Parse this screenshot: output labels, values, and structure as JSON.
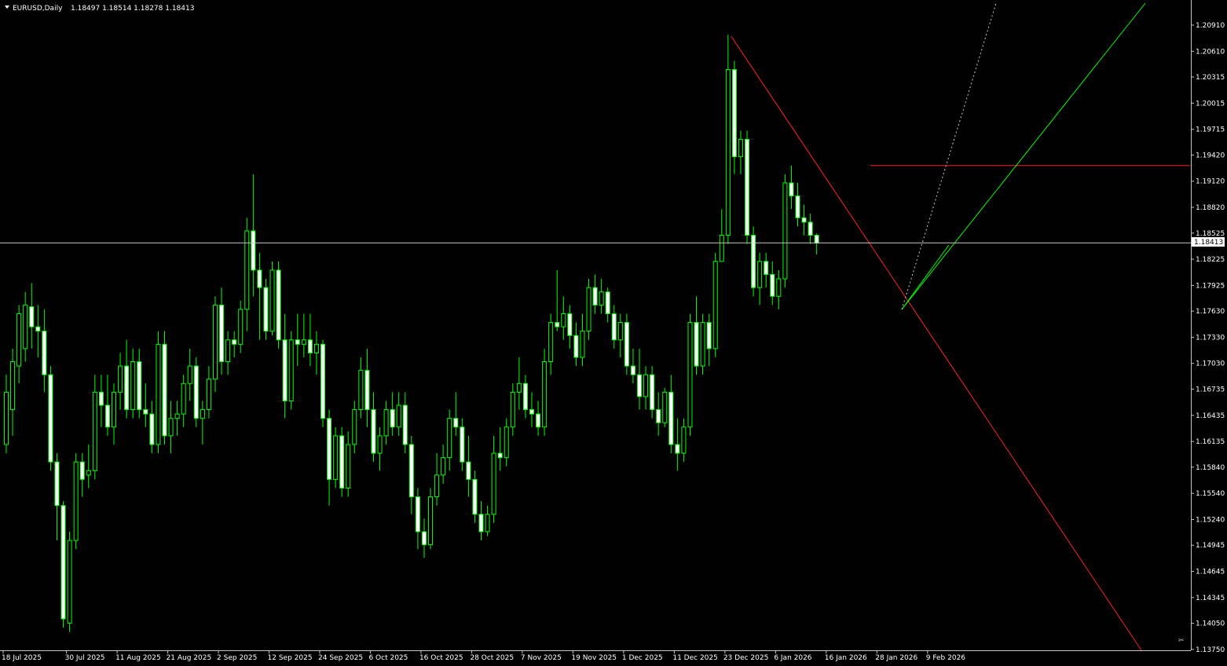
{
  "colors": {
    "background": "#000000",
    "foreground": "#ffffff",
    "bull": "#00ff00",
    "bull_body": "#000000",
    "bear_body": "#ffffff",
    "wick": "#00ff00",
    "bid_line": "#c8c8c8",
    "red_lines": "#ff2020",
    "green_lines": "#00ff00",
    "dotted_line": "#c8c8c8"
  },
  "header": {
    "symbol_text": "EURUSD,Daily",
    "ohlc_text": "1.18497 1.18514 1.18278 1.18413"
  },
  "price_marker": "1.18413",
  "chart_data": {
    "type": "candlestick",
    "title": "EURUSD,Daily",
    "y_ticks": [
      "1.20910",
      "1.20610",
      "1.20315",
      "1.20015",
      "1.19715",
      "1.19420",
      "1.19120",
      "1.18820",
      "1.18525",
      "1.18225",
      "1.17925",
      "1.17630",
      "1.17330",
      "1.17030",
      "1.16735",
      "1.16435",
      "1.16135",
      "1.15840",
      "1.15540",
      "1.15240",
      "1.14945",
      "1.14645",
      "1.14345",
      "1.14050",
      "1.13750"
    ],
    "y_tick_values": [
      1.2091,
      1.2061,
      1.20315,
      1.20015,
      1.19715,
      1.1942,
      1.1912,
      1.1882,
      1.18525,
      1.18225,
      1.17925,
      1.1763,
      1.1733,
      1.1703,
      1.16735,
      1.16435,
      1.16135,
      1.1584,
      1.1554,
      1.1524,
      1.14945,
      1.14645,
      1.14345,
      1.1405,
      1.1375
    ],
    "ylim": [
      1.1374,
      1.2118
    ],
    "x_labels": [
      {
        "label": "18 Jul 2025",
        "bar": 0
      },
      {
        "label": "30 Jul 2025",
        "bar": 10
      },
      {
        "label": "11 Aug 2025",
        "bar": 18
      },
      {
        "label": "21 Aug 2025",
        "bar": 26
      },
      {
        "label": "2 Sep 2025",
        "bar": 34
      },
      {
        "label": "12 Sep 2025",
        "bar": 42
      },
      {
        "label": "24 Sep 2025",
        "bar": 50
      },
      {
        "label": "6 Oct 2025",
        "bar": 58
      },
      {
        "label": "16 Oct 2025",
        "bar": 66
      },
      {
        "label": "28 Oct 2025",
        "bar": 74
      },
      {
        "label": "7 Nov 2025",
        "bar": 82
      },
      {
        "label": "19 Nov 2025",
        "bar": 90
      },
      {
        "label": "1 Dec 2025",
        "bar": 98
      },
      {
        "label": "11 Dec 2025",
        "bar": 106
      },
      {
        "label": "23 Dec 2025",
        "bar": 114
      },
      {
        "label": "6 Jan 2026",
        "bar": 122
      },
      {
        "label": "16 Jan 2026",
        "bar": 130
      },
      {
        "label": "28 Jan 2026",
        "bar": 138
      },
      {
        "label": "9 Feb 2026",
        "bar": 146
      }
    ],
    "candles": [
      [
        1.161,
        1.169,
        1.16,
        1.167
      ],
      [
        1.165,
        1.172,
        1.162,
        1.1705
      ],
      [
        1.17,
        1.177,
        1.168,
        1.176
      ],
      [
        1.172,
        1.1785,
        1.1705,
        1.177
      ],
      [
        1.1768,
        1.1795,
        1.172,
        1.1745
      ],
      [
        1.1745,
        1.177,
        1.171,
        1.174
      ],
      [
        1.174,
        1.1765,
        1.167,
        1.169
      ],
      [
        1.169,
        1.17,
        1.158,
        1.159
      ],
      [
        1.159,
        1.16,
        1.15,
        1.154
      ],
      [
        1.154,
        1.1545,
        1.14,
        1.141
      ],
      [
        1.1405,
        1.151,
        1.1395,
        1.15
      ],
      [
        1.15,
        1.16,
        1.149,
        1.159
      ],
      [
        1.159,
        1.16,
        1.155,
        1.157
      ],
      [
        1.1575,
        1.161,
        1.156,
        1.158
      ],
      [
        1.158,
        1.169,
        1.157,
        1.167
      ],
      [
        1.167,
        1.169,
        1.163,
        1.1655
      ],
      [
        1.1655,
        1.169,
        1.162,
        1.163
      ],
      [
        1.163,
        1.168,
        1.161,
        1.167
      ],
      [
        1.167,
        1.1715,
        1.165,
        1.17
      ],
      [
        1.17,
        1.173,
        1.164,
        1.165
      ],
      [
        1.165,
        1.172,
        1.164,
        1.1705
      ],
      [
        1.1705,
        1.172,
        1.164,
        1.165
      ],
      [
        1.165,
        1.168,
        1.163,
        1.1645
      ],
      [
        1.1645,
        1.166,
        1.16,
        1.161
      ],
      [
        1.161,
        1.174,
        1.16,
        1.1725
      ],
      [
        1.1725,
        1.174,
        1.161,
        1.162
      ],
      [
        1.162,
        1.166,
        1.16,
        1.164
      ],
      [
        1.164,
        1.166,
        1.162,
        1.1645
      ],
      [
        1.1645,
        1.169,
        1.163,
        1.168
      ],
      [
        1.168,
        1.172,
        1.166,
        1.17
      ],
      [
        1.17,
        1.171,
        1.163,
        1.164
      ],
      [
        1.164,
        1.166,
        1.161,
        1.165
      ],
      [
        1.165,
        1.17,
        1.164,
        1.1685
      ],
      [
        1.1685,
        1.178,
        1.167,
        1.177
      ],
      [
        1.177,
        1.179,
        1.169,
        1.1705
      ],
      [
        1.1705,
        1.174,
        1.169,
        1.173
      ],
      [
        1.173,
        1.174,
        1.171,
        1.1725
      ],
      [
        1.1725,
        1.1775,
        1.1715,
        1.1765
      ],
      [
        1.1765,
        1.187,
        1.174,
        1.1855
      ],
      [
        1.1855,
        1.192,
        1.178,
        1.181
      ],
      [
        1.181,
        1.183,
        1.173,
        1.179
      ],
      [
        1.179,
        1.18,
        1.173,
        1.174
      ],
      [
        1.174,
        1.182,
        1.1735,
        1.181
      ],
      [
        1.181,
        1.182,
        1.172,
        1.173
      ],
      [
        1.173,
        1.176,
        1.164,
        1.166
      ],
      [
        1.166,
        1.174,
        1.165,
        1.173
      ],
      [
        1.173,
        1.176,
        1.17,
        1.1725
      ],
      [
        1.1725,
        1.176,
        1.171,
        1.173
      ],
      [
        1.173,
        1.176,
        1.17,
        1.1715
      ],
      [
        1.1715,
        1.174,
        1.169,
        1.1725
      ],
      [
        1.1725,
        1.173,
        1.163,
        1.164
      ],
      [
        1.164,
        1.165,
        1.154,
        1.157
      ],
      [
        1.157,
        1.163,
        1.156,
        1.162
      ],
      [
        1.162,
        1.163,
        1.155,
        1.156
      ],
      [
        1.156,
        1.1625,
        1.155,
        1.161
      ],
      [
        1.161,
        1.166,
        1.16,
        1.165
      ],
      [
        1.165,
        1.171,
        1.164,
        1.1695
      ],
      [
        1.1695,
        1.172,
        1.163,
        1.165
      ],
      [
        1.165,
        1.167,
        1.159,
        1.16
      ],
      [
        1.16,
        1.163,
        1.158,
        1.162
      ],
      [
        1.162,
        1.166,
        1.161,
        1.165
      ],
      [
        1.165,
        1.167,
        1.162,
        1.163
      ],
      [
        1.163,
        1.167,
        1.162,
        1.1655
      ],
      [
        1.1655,
        1.167,
        1.16,
        1.161
      ],
      [
        1.161,
        1.162,
        1.153,
        1.155
      ],
      [
        1.155,
        1.156,
        1.149,
        1.151
      ],
      [
        1.151,
        1.1525,
        1.148,
        1.1495
      ],
      [
        1.1495,
        1.156,
        1.149,
        1.155
      ],
      [
        1.155,
        1.16,
        1.154,
        1.1575
      ],
      [
        1.1575,
        1.161,
        1.1565,
        1.1595
      ],
      [
        1.1595,
        1.165,
        1.158,
        1.164
      ],
      [
        1.164,
        1.167,
        1.162,
        1.163
      ],
      [
        1.163,
        1.164,
        1.158,
        1.159
      ],
      [
        1.159,
        1.162,
        1.155,
        1.157
      ],
      [
        1.157,
        1.158,
        1.152,
        1.153
      ],
      [
        1.153,
        1.1545,
        1.15,
        1.151
      ],
      [
        1.151,
        1.154,
        1.1505,
        1.153
      ],
      [
        1.153,
        1.162,
        1.152,
        1.16
      ],
      [
        1.16,
        1.163,
        1.158,
        1.1595
      ],
      [
        1.1595,
        1.164,
        1.1585,
        1.163
      ],
      [
        1.163,
        1.168,
        1.162,
        1.167
      ],
      [
        1.167,
        1.171,
        1.165,
        1.168
      ],
      [
        1.168,
        1.169,
        1.164,
        1.165
      ],
      [
        1.165,
        1.167,
        1.163,
        1.1645
      ],
      [
        1.1645,
        1.166,
        1.162,
        1.163
      ],
      [
        1.163,
        1.172,
        1.162,
        1.1705
      ],
      [
        1.1705,
        1.176,
        1.169,
        1.175
      ],
      [
        1.175,
        1.181,
        1.174,
        1.1745
      ],
      [
        1.1745,
        1.178,
        1.173,
        1.176
      ],
      [
        1.176,
        1.177,
        1.172,
        1.1735
      ],
      [
        1.1735,
        1.175,
        1.17,
        1.171
      ],
      [
        1.171,
        1.176,
        1.17,
        1.174
      ],
      [
        1.174,
        1.18,
        1.173,
        1.179
      ],
      [
        1.179,
        1.1805,
        1.176,
        1.177
      ],
      [
        1.177,
        1.18,
        1.176,
        1.1785
      ],
      [
        1.1785,
        1.179,
        1.175,
        1.176
      ],
      [
        1.176,
        1.177,
        1.172,
        1.173
      ],
      [
        1.173,
        1.176,
        1.171,
        1.175
      ],
      [
        1.175,
        1.176,
        1.169,
        1.17
      ],
      [
        1.17,
        1.172,
        1.168,
        1.169
      ],
      [
        1.169,
        1.172,
        1.165,
        1.1665
      ],
      [
        1.1665,
        1.17,
        1.165,
        1.169
      ],
      [
        1.169,
        1.17,
        1.164,
        1.165
      ],
      [
        1.165,
        1.167,
        1.162,
        1.1635
      ],
      [
        1.1635,
        1.1675,
        1.163,
        1.167
      ],
      [
        1.167,
        1.169,
        1.16,
        1.161
      ],
      [
        1.161,
        1.164,
        1.158,
        1.16
      ],
      [
        1.16,
        1.164,
        1.159,
        1.163
      ],
      [
        1.163,
        1.176,
        1.162,
        1.175
      ],
      [
        1.175,
        1.178,
        1.169,
        1.17
      ],
      [
        1.17,
        1.176,
        1.169,
        1.175
      ],
      [
        1.175,
        1.176,
        1.17,
        1.172
      ],
      [
        1.172,
        1.183,
        1.171,
        1.182
      ],
      [
        1.182,
        1.188,
        1.182,
        1.185
      ],
      [
        1.185,
        1.208,
        1.184,
        1.204
      ],
      [
        1.204,
        1.205,
        1.192,
        1.194
      ],
      [
        1.194,
        1.197,
        1.192,
        1.196
      ],
      [
        1.196,
        1.197,
        1.184,
        1.185
      ],
      [
        1.185,
        1.186,
        1.178,
        1.179
      ],
      [
        1.179,
        1.183,
        1.177,
        1.182
      ],
      [
        1.182,
        1.183,
        1.179,
        1.1805
      ],
      [
        1.1805,
        1.182,
        1.177,
        1.178
      ],
      [
        1.178,
        1.181,
        1.1765,
        1.18
      ],
      [
        1.18,
        1.192,
        1.179,
        1.191
      ],
      [
        1.191,
        1.193,
        1.188,
        1.1895
      ],
      [
        1.1895,
        1.191,
        1.186,
        1.187
      ],
      [
        1.187,
        1.1885,
        1.185,
        1.1865
      ],
      [
        1.1865,
        1.1875,
        1.184,
        1.185
      ],
      [
        1.185,
        1.1852,
        1.1828,
        1.1841
      ]
    ],
    "bid": 1.18413,
    "drawings": {
      "red_trend": {
        "from": {
          "bar": 114,
          "price": 1.208
        },
        "to": {
          "bar": 147,
          "price": 1.184
        }
      },
      "red_horizontal": {
        "from_bar": 134,
        "price": 1.193
      },
      "green_trend_line": {
        "from": {
          "bar": 130,
          "price": 1.1765
        },
        "to": {
          "bar": 150,
          "price": 1.184
        }
      },
      "dotted_trend_line": {
        "from": {
          "bar": 130,
          "price": 1.1765
        },
        "to": {
          "bar": 137,
          "price": 1.188
        }
      }
    },
    "grid": false,
    "legend": "none"
  }
}
